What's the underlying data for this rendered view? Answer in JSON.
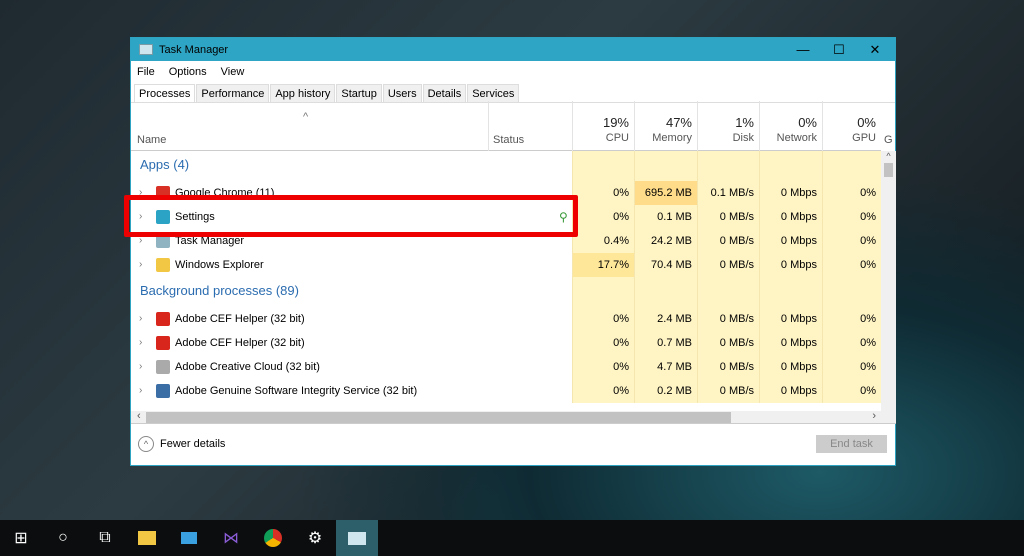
{
  "window": {
    "title": "Task Manager",
    "minimize": "—",
    "maximize": "☐",
    "close": "✕"
  },
  "menu": [
    "File",
    "Options",
    "View"
  ],
  "tabs": [
    "Processes",
    "Performance",
    "App history",
    "Startup",
    "Users",
    "Details",
    "Services"
  ],
  "header": {
    "sort_arrow": "^",
    "name": "Name",
    "status": "Status",
    "columns": [
      {
        "pct": "19%",
        "label": "CPU"
      },
      {
        "pct": "47%",
        "label": "Memory"
      },
      {
        "pct": "1%",
        "label": "Disk"
      },
      {
        "pct": "0%",
        "label": "Network"
      },
      {
        "pct": "0%",
        "label": "GPU"
      }
    ],
    "cut_label": "G"
  },
  "groups": [
    {
      "label": "Apps (4)",
      "rows": [
        {
          "name": "Google Chrome (11)",
          "icon": "chrome-icon",
          "color": "#d93025",
          "status": "",
          "cells": [
            "0%",
            "695.2 MB",
            "0.1 MB/s",
            "0 Mbps",
            "0%"
          ]
        },
        {
          "name": "Settings",
          "icon": "settings-icon",
          "color": "#2aa3c4",
          "status": "suspended-leaf",
          "cells": [
            "0%",
            "0.1 MB",
            "0 MB/s",
            "0 Mbps",
            "0%"
          ]
        },
        {
          "name": "Task Manager",
          "icon": "task-manager-icon",
          "color": "#8fb3c0",
          "status": "",
          "cells": [
            "0.4%",
            "24.2 MB",
            "0 MB/s",
            "0 Mbps",
            "0%"
          ]
        },
        {
          "name": "Windows Explorer",
          "icon": "folder-icon",
          "color": "#f2c744",
          "status": "",
          "cells": [
            "17.7%",
            "70.4 MB",
            "0 MB/s",
            "0 Mbps",
            "0%"
          ]
        }
      ]
    },
    {
      "label": "Background processes (89)",
      "rows": [
        {
          "name": "Adobe CEF Helper (32 bit)",
          "icon": "adobe-icon",
          "color": "#d9261c",
          "status": "",
          "cells": [
            "0%",
            "2.4 MB",
            "0 MB/s",
            "0 Mbps",
            "0%"
          ]
        },
        {
          "name": "Adobe CEF Helper (32 bit)",
          "icon": "adobe-icon",
          "color": "#d9261c",
          "status": "",
          "cells": [
            "0%",
            "0.7 MB",
            "0 MB/s",
            "0 Mbps",
            "0%"
          ]
        },
        {
          "name": "Adobe Creative Cloud (32 bit)",
          "icon": "creative-cloud-icon",
          "color": "#aaaaaa",
          "status": "",
          "cells": [
            "0%",
            "4.7 MB",
            "0 MB/s",
            "0 Mbps",
            "0%"
          ]
        },
        {
          "name": "Adobe Genuine Software Integrity Service (32 bit)",
          "icon": "service-icon",
          "color": "#3a6ea5",
          "status": "",
          "cells": [
            "0%",
            "0.2 MB",
            "0 MB/s",
            "0 Mbps",
            "0%"
          ]
        }
      ]
    }
  ],
  "footer": {
    "fewer_details": "Fewer details",
    "end_task": "End task"
  },
  "taskbar": [
    "start",
    "search",
    "task-view",
    "file-explorer",
    "this-pc",
    "visual-studio",
    "chrome",
    "settings",
    "task-manager"
  ],
  "colors": {
    "titlebar": "#2ea5c4",
    "heat_low": "#fff4c4",
    "heat_high": "#ffe08a",
    "highlight": "#e00000"
  }
}
